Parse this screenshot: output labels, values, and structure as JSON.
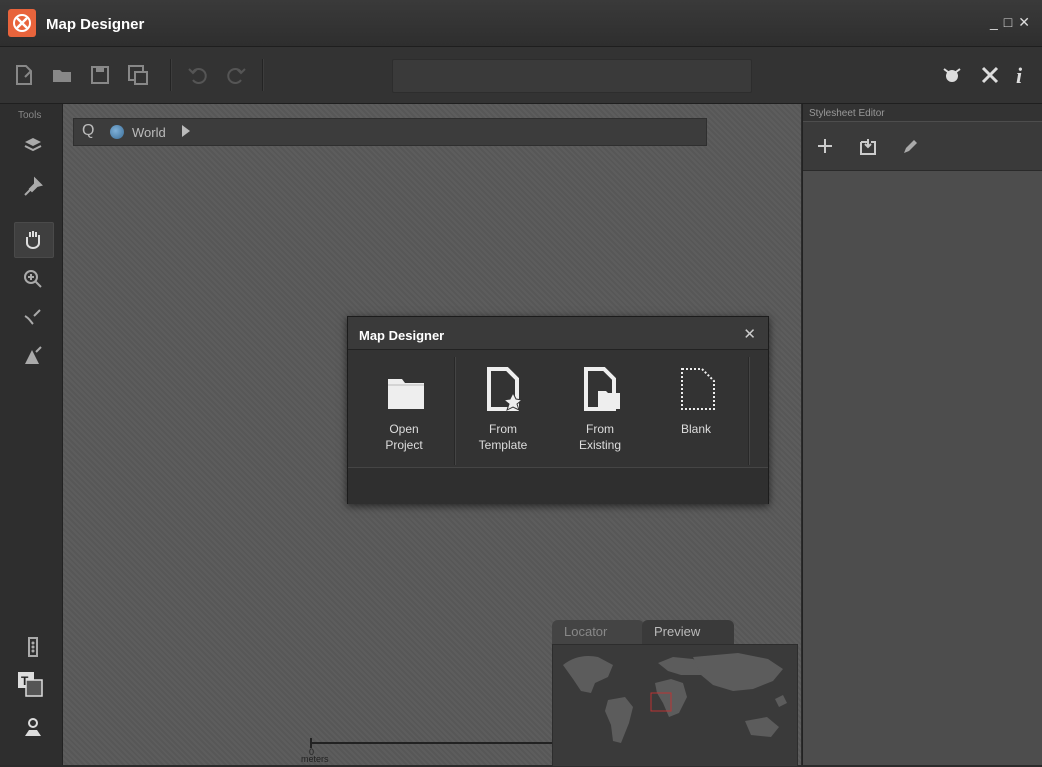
{
  "app": {
    "title": "Map Designer"
  },
  "window_controls": [
    "minimize-icon",
    "maximize-icon",
    "close-icon"
  ],
  "toolbar": {
    "buttons": [
      "new-file-icon",
      "open-folder-icon",
      "save-icon",
      "save-as-icon",
      "undo-icon",
      "redo-icon"
    ],
    "search_value": "",
    "right_buttons": [
      "alarm-icon",
      "settings-tools-icon",
      "info-icon"
    ],
    "info_label": "i"
  },
  "tools_panel": {
    "label": "Tools",
    "tools": [
      "layers-icon",
      "pin-icon",
      "pan-hand-icon",
      "zoom-in-icon",
      "edit-nodes-icon",
      "edit-shape-icon"
    ],
    "bottom_tools": [
      "traffic-light-icon",
      "text-tool-icon",
      "route-pin-icon"
    ]
  },
  "breadcrumb": {
    "search_label": "Q",
    "location": "World"
  },
  "dialog": {
    "title": "Map Designer",
    "close_label": "✕",
    "options": [
      {
        "label": "Open\nProject",
        "icon": "folder-icon"
      },
      {
        "label": "From\nTemplate",
        "icon": "template-icon"
      },
      {
        "label": "From\nExisting",
        "icon": "existing-icon"
      },
      {
        "label": "Blank",
        "icon": "blank-page-icon"
      }
    ]
  },
  "stylesheet_editor": {
    "label": "Stylesheet Editor",
    "tools": [
      "add-icon",
      "import-icon",
      "edit-pencil-icon"
    ]
  },
  "locator": {
    "tabs": [
      "Locator",
      "Preview"
    ],
    "active_tab": "Preview"
  },
  "scale": {
    "label": "meters",
    "zero": "0"
  },
  "colors": {
    "accent": "#e8643c",
    "background": "#2b2b2b",
    "canvas": "#5a5a5a"
  }
}
